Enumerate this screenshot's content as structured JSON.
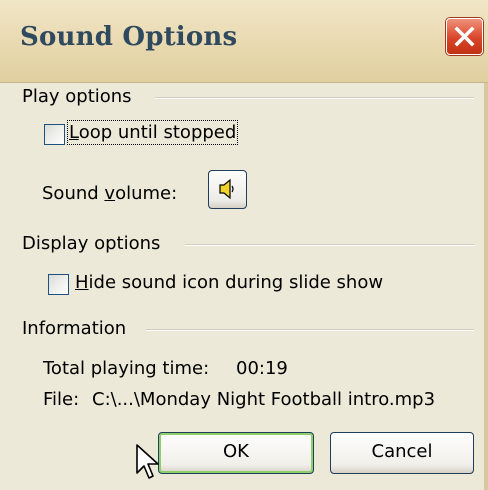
{
  "window": {
    "title": "Sound Options"
  },
  "play_options": {
    "group_label": "Play options",
    "loop_checkbox": {
      "label_prefix": "",
      "label_mnemonic": "L",
      "label_rest": "oop until stopped",
      "checked": false
    },
    "volume": {
      "label_prefix": "Sound ",
      "label_mnemonic": "v",
      "label_rest": "olume:",
      "icon": "speaker-icon"
    }
  },
  "display_options": {
    "group_label": "Display options",
    "hide_icon_checkbox": {
      "label_prefix": "",
      "label_mnemonic": "H",
      "label_rest": "ide sound icon during slide show",
      "checked": false
    }
  },
  "information": {
    "group_label": "Information",
    "total_time_label": "Total playing time:",
    "total_time_value": "00:19",
    "file_label": "File:",
    "file_value": "C:\\...\\Monday Night Football intro.mp3"
  },
  "buttons": {
    "ok": "OK",
    "cancel": "Cancel"
  },
  "colors": {
    "accent_green": "#8fcf6a",
    "title_text": "#2f4a5e",
    "close_red": "#d9452a"
  }
}
